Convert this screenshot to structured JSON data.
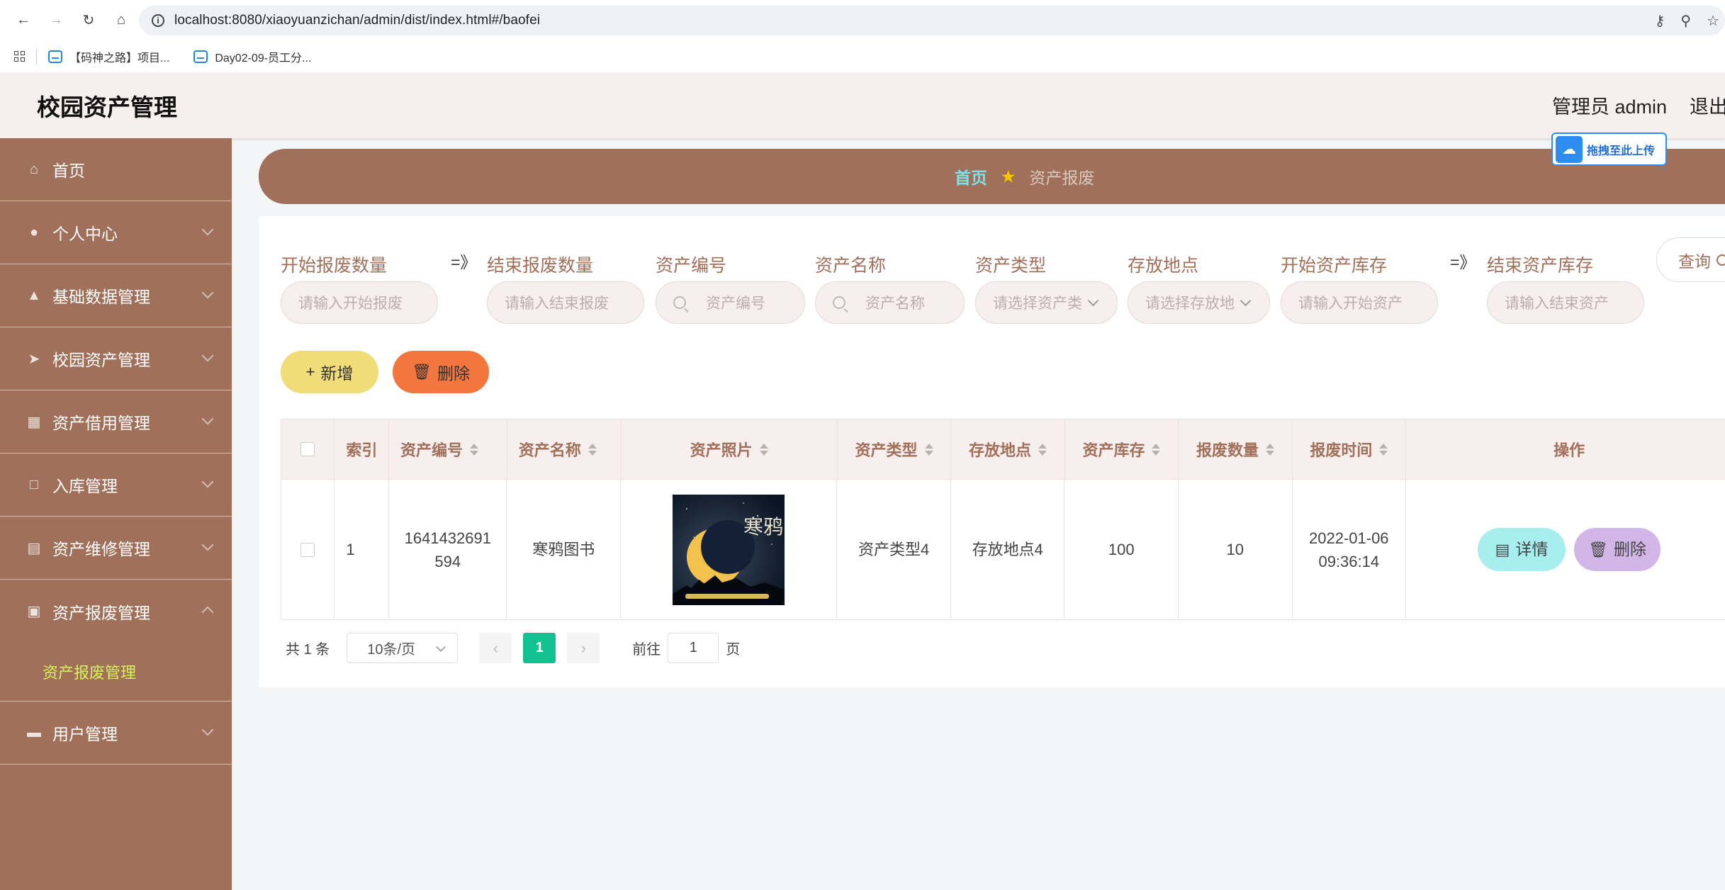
{
  "browser": {
    "url": "localhost:8080/xiaoyuanzichan/admin/dist/index.html#/baofei",
    "bookmarks": [
      "【码神之路】项目...",
      "Day02-09-员工分..."
    ]
  },
  "header": {
    "title": "校园资产管理",
    "user": "管理员 admin",
    "logout": "退出"
  },
  "upload_float": {
    "label": "拖拽至此上传"
  },
  "sidebar": {
    "items": [
      {
        "label": "首页",
        "icon": "home-icon"
      },
      {
        "label": "个人中心",
        "icon": "user-icon"
      },
      {
        "label": "基础数据管理",
        "icon": "stamp-icon"
      },
      {
        "label": "校园资产管理",
        "icon": "send-icon"
      },
      {
        "label": "资产借用管理",
        "icon": "grid-icon"
      },
      {
        "label": "入库管理",
        "icon": "crop-icon"
      },
      {
        "label": "资产维修管理",
        "icon": "chart-icon"
      },
      {
        "label": "资产报废管理",
        "icon": "briefcase-icon"
      },
      {
        "label": "用户管理",
        "icon": "ticket-icon"
      }
    ],
    "active_sub": "资产报废管理"
  },
  "breadcrumb": {
    "home": "首页",
    "current": "资产报废"
  },
  "search": {
    "fields": [
      {
        "label": "开始报废数量",
        "placeholder": "请输入开始报废"
      },
      {
        "label": "结束报废数量",
        "placeholder": "请输入结束报废"
      },
      {
        "label": "资产编号",
        "placeholder": "资产编号"
      },
      {
        "label": "资产名称",
        "placeholder": "资产名称"
      },
      {
        "label": "资产类型",
        "placeholder": "请选择资产类"
      },
      {
        "label": "存放地点",
        "placeholder": "请选择存放地"
      },
      {
        "label": "开始资产库存",
        "placeholder": "请输入开始资产"
      },
      {
        "label": "结束资产库存",
        "placeholder": "请输入结束资产"
      }
    ],
    "range_arrow": "=》",
    "query_label": "查询"
  },
  "actions": {
    "add": "新增",
    "delete": "删除"
  },
  "table": {
    "columns": [
      "索引",
      "资产编号",
      "资产名称",
      "资产照片",
      "资产类型",
      "存放地点",
      "资产库存",
      "报废数量",
      "报废时间",
      "操作"
    ],
    "rows": [
      {
        "index": "1",
        "code_line1": "1641432691",
        "code_line2": "594",
        "name": "寒鸦图书",
        "photo_title": "寒鸦",
        "type": "资产类型4",
        "location": "存放地点4",
        "stock": "100",
        "scrap_qty": "10",
        "time_line1": "2022-01-06",
        "time_line2": "09:36:14",
        "detail_label": "详情",
        "delete_label": "删除"
      }
    ]
  },
  "pagination": {
    "total": "共 1 条",
    "page_size": "10条/页",
    "current_page": "1",
    "goto_label": "前往",
    "goto_value": "1",
    "page_unit": "页"
  },
  "colors": {
    "brand": "#a1705a",
    "header_bg": "#f7eeee",
    "active_sub": "#d6f25a",
    "pager_active": "#13c08f"
  }
}
